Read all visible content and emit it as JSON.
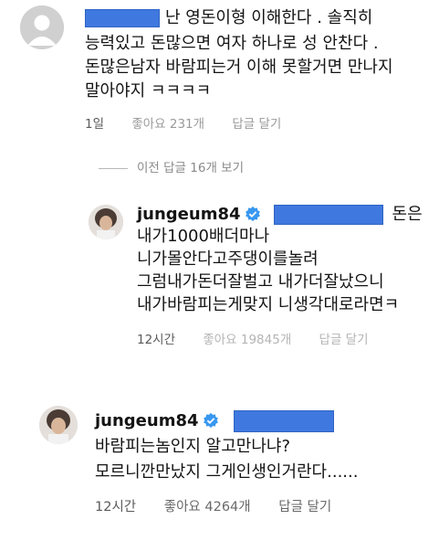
{
  "comment1": {
    "text_line1": "난 영돈이형 이해한다 . 솔직히",
    "text_line2": "능력있고 돈많으면 여자 하나로 성 안찬다 .",
    "text_line3": "돈많은남자 바람피는거 이해 못할거면 만나지",
    "text_line4": "말아야지 ㅋㅋㅋㅋ",
    "time": "1일",
    "likes": "좋아요 231개",
    "reply": "답글 달기"
  },
  "view_previous": "이전 답글 16개 보기",
  "reply1": {
    "username": "jungeum84",
    "text_line1_suffix": "돈은",
    "text_line2": "내가1000배더마나",
    "text_line3": "니가몰안다고주댕이를놀려",
    "text_line4": "그럼내가돈더잘벌고 내가더잘났으니",
    "text_line5": "내가바람피는게맞지 니생각대로라면ㅋ",
    "time": "12시간",
    "likes": "좋아요 19845개",
    "reply": "답글 달기"
  },
  "reply2": {
    "username": "jungeum84",
    "text_line1": "바람피는놈인지 알고만나냐?",
    "text_line2": "모르니깐만났지 그게인생인거란다......",
    "time": "12시간",
    "likes": "좋아요 4264개",
    "reply": "답글 달기"
  },
  "colors": {
    "redaction": "#3f79df",
    "verified": "#3897f0"
  },
  "icons": {
    "verified": "verified-badge-icon",
    "avatar_default": "default-avatar-icon"
  }
}
